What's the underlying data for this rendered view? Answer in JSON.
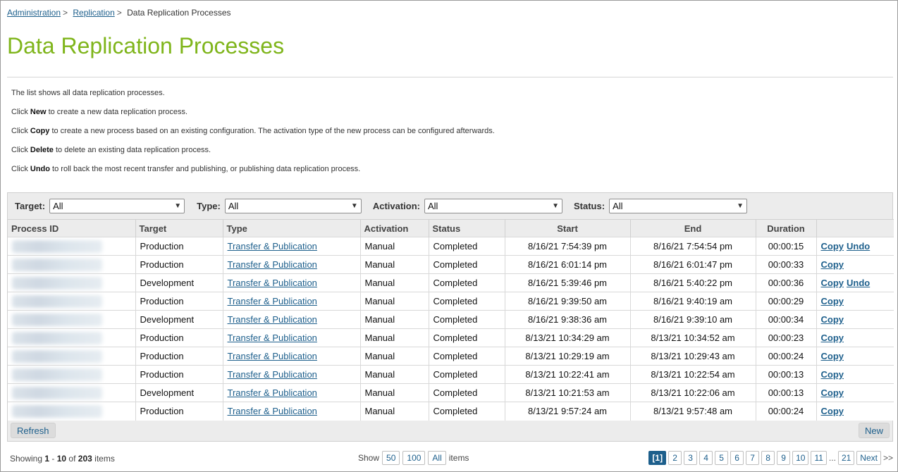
{
  "breadcrumb": {
    "items": [
      "Administration",
      "Replication"
    ],
    "current": "Data Replication Processes",
    "sep": ">"
  },
  "page_title": "Data Replication Processes",
  "help": [
    {
      "pre": "The list shows all data replication processes.",
      "bold": "",
      "post": ""
    },
    {
      "pre": "Click ",
      "bold": "New",
      "post": " to create a new data replication process."
    },
    {
      "pre": "Click ",
      "bold": "Copy",
      "post": " to create a new process based on an existing configuration. The activation type of the new process can be configured afterwards."
    },
    {
      "pre": "Click ",
      "bold": "Delete",
      "post": " to delete an existing data replication process."
    },
    {
      "pre": "Click ",
      "bold": "Undo",
      "post": " to roll back the most recent transfer and publishing, or publishing data replication process."
    }
  ],
  "filters": [
    {
      "label": "Target:",
      "value": "All"
    },
    {
      "label": "Type:",
      "value": "All"
    },
    {
      "label": "Activation:",
      "value": "All"
    },
    {
      "label": "Status:",
      "value": "All"
    }
  ],
  "columns": [
    "Process ID",
    "Target",
    "Type",
    "Activation",
    "Status",
    "Start",
    "End",
    "Duration",
    ""
  ],
  "rows": [
    {
      "target": "Production",
      "type": "Transfer & Publication",
      "activation": "Manual",
      "status": "Completed",
      "start": "8/16/21 7:54:39 pm",
      "end": "8/16/21 7:54:54 pm",
      "duration": "00:00:15",
      "actions": [
        "Copy",
        "Undo"
      ]
    },
    {
      "target": "Production",
      "type": "Transfer & Publication",
      "activation": "Manual",
      "status": "Completed",
      "start": "8/16/21 6:01:14 pm",
      "end": "8/16/21 6:01:47 pm",
      "duration": "00:00:33",
      "actions": [
        "Copy"
      ]
    },
    {
      "target": "Development",
      "type": "Transfer & Publication",
      "activation": "Manual",
      "status": "Completed",
      "start": "8/16/21 5:39:46 pm",
      "end": "8/16/21 5:40:22 pm",
      "duration": "00:00:36",
      "actions": [
        "Copy",
        "Undo"
      ]
    },
    {
      "target": "Production",
      "type": "Transfer & Publication",
      "activation": "Manual",
      "status": "Completed",
      "start": "8/16/21 9:39:50 am",
      "end": "8/16/21 9:40:19 am",
      "duration": "00:00:29",
      "actions": [
        "Copy"
      ]
    },
    {
      "target": "Development",
      "type": "Transfer & Publication",
      "activation": "Manual",
      "status": "Completed",
      "start": "8/16/21 9:38:36 am",
      "end": "8/16/21 9:39:10 am",
      "duration": "00:00:34",
      "actions": [
        "Copy"
      ]
    },
    {
      "target": "Production",
      "type": "Transfer & Publication",
      "activation": "Manual",
      "status": "Completed",
      "start": "8/13/21 10:34:29 am",
      "end": "8/13/21 10:34:52 am",
      "duration": "00:00:23",
      "actions": [
        "Copy"
      ]
    },
    {
      "target": "Production",
      "type": "Transfer & Publication",
      "activation": "Manual",
      "status": "Completed",
      "start": "8/13/21 10:29:19 am",
      "end": "8/13/21 10:29:43 am",
      "duration": "00:00:24",
      "actions": [
        "Copy"
      ]
    },
    {
      "target": "Production",
      "type": "Transfer & Publication",
      "activation": "Manual",
      "status": "Completed",
      "start": "8/13/21 10:22:41 am",
      "end": "8/13/21 10:22:54 am",
      "duration": "00:00:13",
      "actions": [
        "Copy"
      ]
    },
    {
      "target": "Development",
      "type": "Transfer & Publication",
      "activation": "Manual",
      "status": "Completed",
      "start": "8/13/21 10:21:53 am",
      "end": "8/13/21 10:22:06 am",
      "duration": "00:00:13",
      "actions": [
        "Copy"
      ]
    },
    {
      "target": "Production",
      "type": "Transfer & Publication",
      "activation": "Manual",
      "status": "Completed",
      "start": "8/13/21 9:57:24 am",
      "end": "8/13/21 9:57:48 am",
      "duration": "00:00:24",
      "actions": [
        "Copy"
      ]
    }
  ],
  "buttons": {
    "refresh": "Refresh",
    "new": "New"
  },
  "footer": {
    "showing_prefix": "Showing ",
    "range_start": "1",
    "range_sep": " - ",
    "range_end": "10",
    "of": " of ",
    "total": "203",
    "items": " items",
    "show_label": "Show",
    "sizes": [
      "50",
      "100",
      "All"
    ],
    "items_label": "items",
    "pages": [
      "[1]",
      "2",
      "3",
      "4",
      "5",
      "6",
      "7",
      "8",
      "9",
      "10",
      "11"
    ],
    "ellipsis": "...",
    "last_page": "21",
    "next": "Next",
    "last": ">>"
  }
}
